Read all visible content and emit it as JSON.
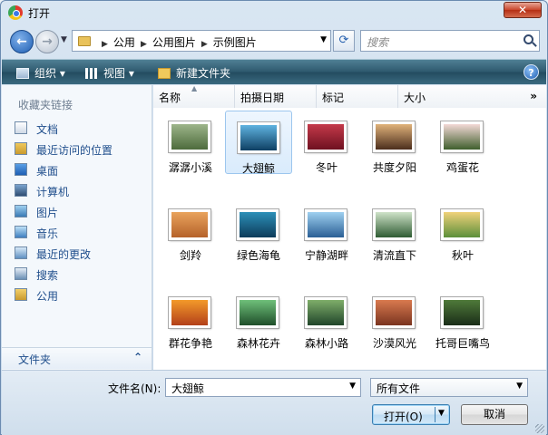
{
  "window": {
    "title": "打开",
    "close_label": "✕"
  },
  "address": {
    "crumbs": [
      "公用",
      "公用图片",
      "示例图片"
    ],
    "search_placeholder": "搜索"
  },
  "toolbar": {
    "organize": "组织 ▾",
    "views": "视图 ▾",
    "new_folder": "新建文件夹",
    "help": "?"
  },
  "sidebar": {
    "header": "收藏夹链接",
    "items": [
      {
        "label": "文档",
        "icon": "documents-icon"
      },
      {
        "label": "最近访问的位置",
        "icon": "recent-places-icon"
      },
      {
        "label": "桌面",
        "icon": "desktop-icon"
      },
      {
        "label": "计算机",
        "icon": "computer-icon"
      },
      {
        "label": "图片",
        "icon": "pictures-icon"
      },
      {
        "label": "音乐",
        "icon": "music-icon"
      },
      {
        "label": "最近的更改",
        "icon": "recently-changed-icon"
      },
      {
        "label": "搜索",
        "icon": "searches-icon"
      },
      {
        "label": "公用",
        "icon": "public-folder-icon"
      }
    ],
    "folders_label": "文件夹"
  },
  "columns": [
    "名称",
    "拍摄日期",
    "标记",
    "大小"
  ],
  "files": [
    {
      "name": "潺潺小溪",
      "colors": [
        "#9db58a",
        "#4d6b3c"
      ]
    },
    {
      "name": "大翅鲸",
      "colors": [
        "#5fb3e0",
        "#0e3f63"
      ]
    },
    {
      "name": "冬叶",
      "colors": [
        "#c43a4a",
        "#6e1020"
      ]
    },
    {
      "name": "共度夕阳",
      "colors": [
        "#e0b27a",
        "#4b2e1c"
      ]
    },
    {
      "name": "鸡蛋花",
      "colors": [
        "#f3d9d6",
        "#3f5f2d"
      ]
    },
    {
      "name": "剑羚",
      "colors": [
        "#e9a35d",
        "#b5622a"
      ]
    },
    {
      "name": "绿色海龟",
      "colors": [
        "#2c8fb8",
        "#0d3b5a"
      ]
    },
    {
      "name": "宁静湖畔",
      "colors": [
        "#9fd0f0",
        "#2a5f95"
      ]
    },
    {
      "name": "清流直下",
      "colors": [
        "#cfe3c9",
        "#2f5c33"
      ]
    },
    {
      "name": "秋叶",
      "colors": [
        "#f0d27a",
        "#5c8f3a"
      ]
    },
    {
      "name": "群花争艳",
      "colors": [
        "#f39a2a",
        "#b3401a"
      ]
    },
    {
      "name": "森林花卉",
      "colors": [
        "#6fc07a",
        "#1f4f2a"
      ]
    },
    {
      "name": "森林小路",
      "colors": [
        "#7fae6a",
        "#20452a"
      ]
    },
    {
      "name": "沙漠风光",
      "colors": [
        "#d97a4f",
        "#7a3420"
      ]
    },
    {
      "name": "托哥巨嘴鸟",
      "colors": [
        "#4f7a3a",
        "#1a2d18"
      ]
    }
  ],
  "selected_file": "大翅鲸",
  "bottom": {
    "filename_label": "文件名(N):",
    "filename_value": "大翅鲸",
    "filetype_value": "所有文件",
    "open_label": "打开(O)",
    "cancel_label": "取消"
  }
}
